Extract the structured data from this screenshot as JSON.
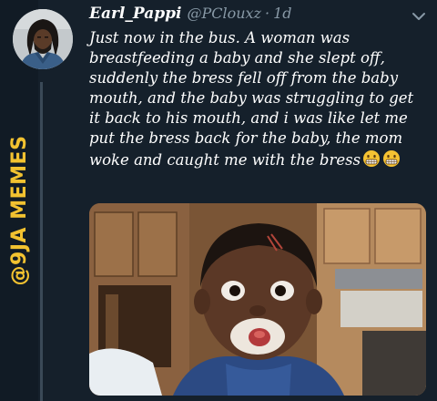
{
  "watermark": {
    "text": "@9JA MEMES"
  },
  "tweet": {
    "display_name": "Earl_Pappi",
    "handle": "@PClouxz",
    "separator": "·",
    "time": "1d",
    "text_lines": [
      "Just now in the bus. A woman was",
      "breastfeeding a baby and she slept off,",
      "suddenly the bress fell off from the baby",
      "mouth, and the baby was struggling to get",
      "it back to his mouth, and i was like let me",
      "put the bress back for the baby, the mom",
      "woke and caught me with the bress"
    ],
    "trailing_emojis": [
      "grimacing-face-emoji",
      "grimacing-face-emoji"
    ]
  },
  "icons": {
    "chevron": "chevron-down-icon",
    "emoji": "grimacing-face-emoji"
  },
  "colors": {
    "background": "#15202b",
    "secondary_text": "#8899a6",
    "watermark": "#f2c230"
  }
}
